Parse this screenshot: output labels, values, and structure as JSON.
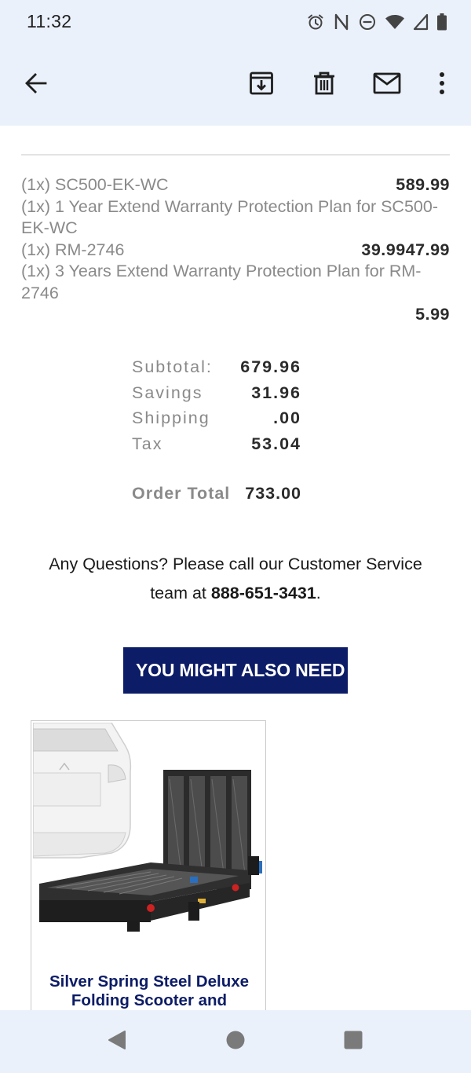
{
  "status_bar": {
    "time": "11:32",
    "icons": [
      "alarm-icon",
      "nfc-icon",
      "do-not-disturb-icon",
      "wifi-icon",
      "signal-icon",
      "battery-icon"
    ]
  },
  "toolbar": {
    "actions": [
      "back-arrow-icon",
      "archive-icon",
      "delete-icon",
      "mark-unread-icon",
      "more-options-icon"
    ]
  },
  "order": {
    "line_items": [
      {
        "desc": "(1x) SC500-EK-WC",
        "price": "589.99"
      },
      {
        "desc": "(1x) 1 Year Extend Warranty Protection Plan for SC500-EK-WC",
        "price": ""
      },
      {
        "desc": "(1x) RM-2746",
        "price": "39.9947.99"
      },
      {
        "desc": "(1x) 3 Years Extend Warranty Protection Plan for RM-2746",
        "price": ""
      }
    ],
    "trailing_price": "5.99",
    "totals": {
      "subtotal_label": "Subtotal:",
      "subtotal_value": "679.96",
      "savings_label": "Savings",
      "savings_value": "31.96",
      "shipping_label": "Shipping",
      "shipping_value": ".00",
      "tax_label": "Tax",
      "tax_value": "53.04",
      "order_total_label": "Order Total",
      "order_total_value": "733.00"
    }
  },
  "questions": {
    "text": "Any Questions? Please call our Customer Service team at ",
    "phone": "888-651-3431",
    "suffix": "."
  },
  "recommend": {
    "banner_label": "YOU MIGHT ALSO NEED",
    "product_name": "Silver Spring Steel Deluxe Folding Scooter and"
  },
  "nav_bar": {
    "buttons": [
      "nav-back-icon",
      "nav-home-icon",
      "nav-recents-icon"
    ]
  },
  "colors": {
    "bar_background": "#ebf1fb",
    "banner_navy": "#0c1c66",
    "muted_text": "#8a8a8a",
    "strong_text": "#2b2b2b"
  }
}
